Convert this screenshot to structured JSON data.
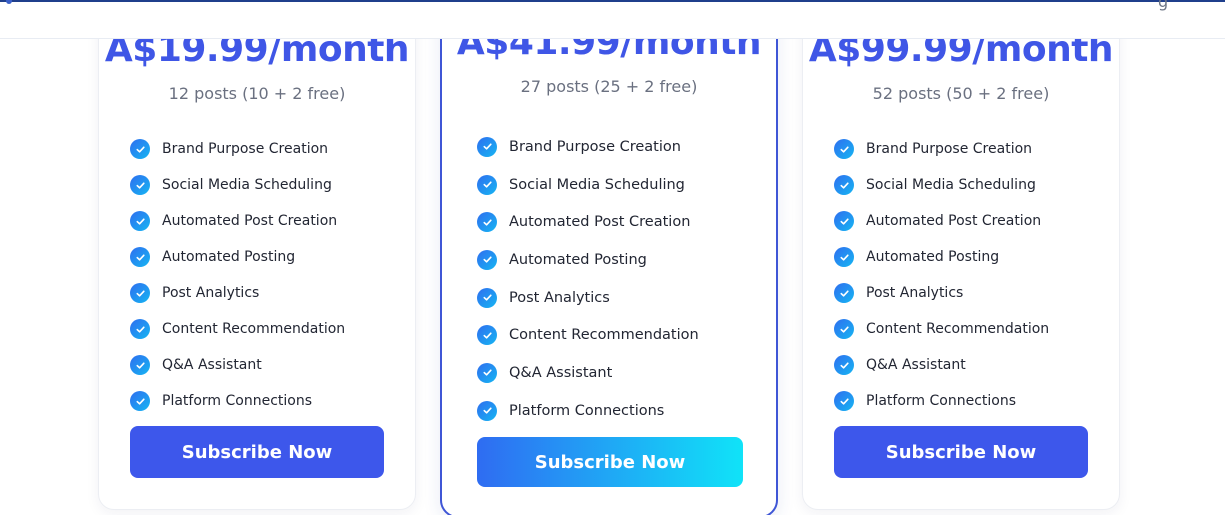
{
  "plans": [
    {
      "price": "A$19.99/month",
      "posts": "12 posts (10 + 2 free)",
      "features": [
        "Brand Purpose Creation",
        "Social Media Scheduling",
        "Automated Post Creation",
        "Automated Posting",
        "Post Analytics",
        "Content Recommendation",
        "Q&A Assistant",
        "Platform Connections"
      ],
      "cta": "Subscribe Now"
    },
    {
      "price": "A$41.99/month",
      "posts": "27 posts (25 + 2 free)",
      "features": [
        "Brand Purpose Creation",
        "Social Media Scheduling",
        "Automated Post Creation",
        "Automated Posting",
        "Post Analytics",
        "Content Recommendation",
        "Q&A Assistant",
        "Platform Connections"
      ],
      "cta": "Subscribe Now"
    },
    {
      "price": "A$99.99/month",
      "posts": "52 posts (50 + 2 free)",
      "features": [
        "Brand Purpose Creation",
        "Social Media Scheduling",
        "Automated Post Creation",
        "Automated Posting",
        "Post Analytics",
        "Content Recommendation",
        "Q&A Assistant",
        "Platform Connections"
      ],
      "cta": "Subscribe Now"
    }
  ],
  "colors": {
    "accent": "#3d57eb",
    "featured_border": "#3f56d6",
    "gradient_start": "#2f6cf2",
    "gradient_end": "#10e3f8"
  },
  "icons": {
    "check": "check-circle-icon"
  }
}
